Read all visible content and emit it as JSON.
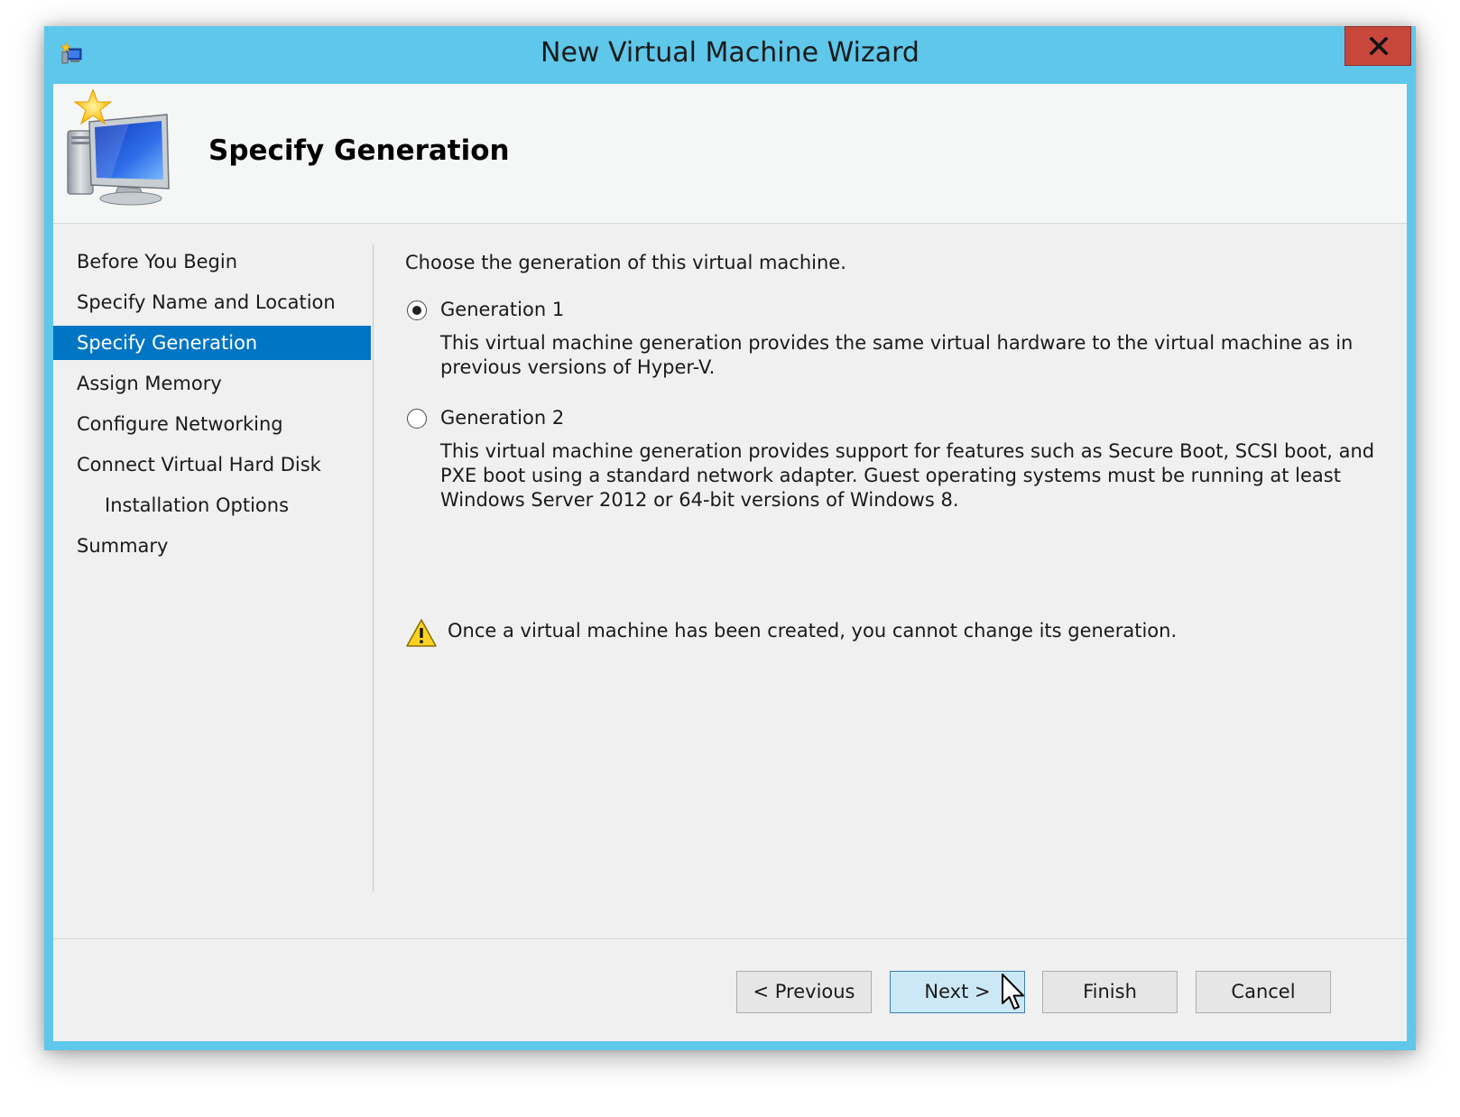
{
  "window": {
    "title": "New Virtual Machine Wizard",
    "close_label": "X"
  },
  "header": {
    "title": "Specify Generation"
  },
  "steps": [
    {
      "label": "Before You Begin",
      "active": false
    },
    {
      "label": "Specify Name and Location",
      "active": false
    },
    {
      "label": "Specify Generation",
      "active": true
    },
    {
      "label": "Assign Memory",
      "active": false
    },
    {
      "label": "Configure Networking",
      "active": false
    },
    {
      "label": "Connect Virtual Hard Disk",
      "active": false
    },
    {
      "label": "Installation Options",
      "active": false,
      "sub": true
    },
    {
      "label": "Summary",
      "active": false
    }
  ],
  "content": {
    "intro": "Choose the generation of this virtual machine.",
    "options": [
      {
        "label": "Generation 1",
        "selected": true,
        "description": "This virtual machine generation provides the same virtual hardware to the virtual machine as in previous versions of Hyper-V."
      },
      {
        "label": "Generation 2",
        "selected": false,
        "description": "This virtual machine generation provides support for features such as Secure Boot, SCSI boot, and PXE boot using a standard network adapter. Guest operating systems must be running at least Windows Server 2012 or 64-bit versions of Windows 8."
      }
    ],
    "warning": "Once a virtual machine has been created, you cannot change its generation."
  },
  "buttons": {
    "previous": "< Previous",
    "next": "Next >",
    "finish": "Finish",
    "cancel": "Cancel"
  },
  "icons": {
    "app": "hyper-v-app-icon",
    "header": "new-computer-star-icon",
    "warning": "warning-triangle-icon",
    "close": "close-icon",
    "cursor": "mouse-pointer-icon"
  },
  "colors": {
    "title_bar": "#5ec7ea",
    "selected_step": "#0075c4",
    "close_button": "#c8473d",
    "default_button": "#cce8f7",
    "client_background": "#f0f0f0"
  }
}
